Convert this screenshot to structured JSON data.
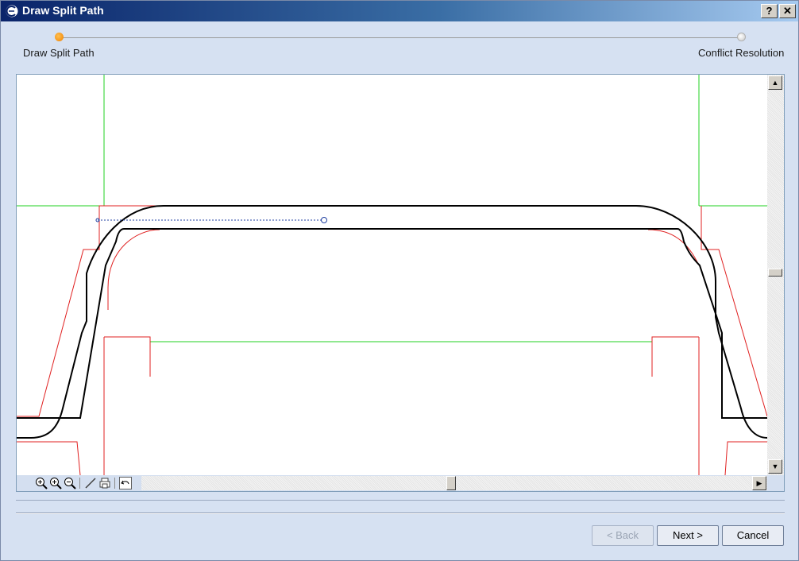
{
  "window": {
    "title": "Draw Split Path",
    "help_label": "?",
    "close_label": "✕"
  },
  "wizard": {
    "steps": [
      {
        "label": "Draw Split Path",
        "state": "current"
      },
      {
        "label": "Conflict Resolution",
        "state": "pending"
      }
    ]
  },
  "toolbar": {
    "tools": [
      "zoom-fit-icon",
      "zoom-in-icon",
      "zoom-out-icon",
      "draw-line-icon",
      "print-preview-icon",
      "undo-icon"
    ]
  },
  "colors": {
    "outline": "#000000",
    "red_lines": "#e02020",
    "green_lines": "#20d020",
    "guide": "#2040a0",
    "title_start": "#0a246a",
    "title_end": "#a6caf0",
    "active_step": "#f08000"
  },
  "buttons": {
    "back": "< Back",
    "next": "Next >",
    "cancel": "Cancel"
  }
}
